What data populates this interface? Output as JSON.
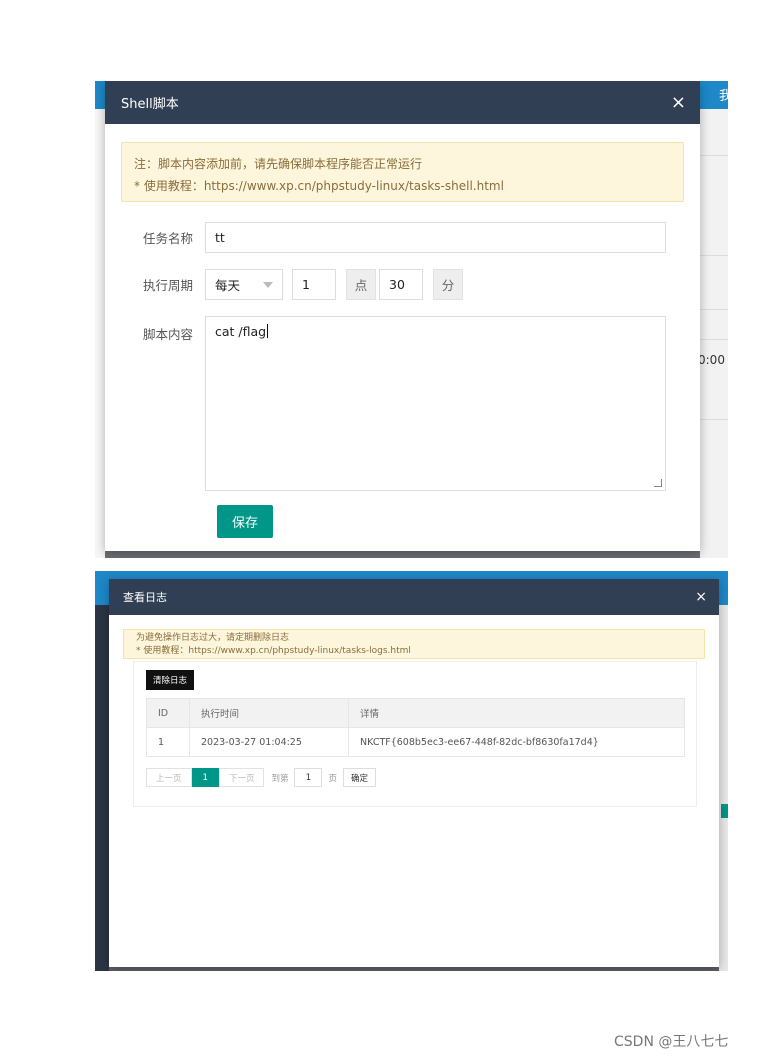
{
  "shell_dialog": {
    "title": "Shell脚本",
    "close": "×",
    "notice": {
      "line1": "注：脚本内容添加前，请先确保脚本程序能否正常运行",
      "line2": "* 使用教程：https://www.xp.cn/phpstudy-linux/tasks-shell.html"
    },
    "task_name": {
      "label": "任务名称",
      "value": "tt"
    },
    "cycle": {
      "label": "执行周期",
      "period_value": "每天",
      "hour_value": "1",
      "hour_unit": "点",
      "minute_value": "30",
      "minute_unit": "分"
    },
    "script": {
      "label": "脚本内容",
      "value": "cat /flag"
    },
    "save_label": "保存"
  },
  "log_dialog": {
    "title": "查看日志",
    "close": "×",
    "notice": {
      "line1": "为避免操作日志过大，请定期删除日志",
      "line2": "* 使用教程：https://www.xp.cn/phpstudy-linux/tasks-logs.html"
    },
    "clear_label": "清除日志",
    "table": {
      "headers": [
        "ID",
        "执行时间",
        "详情"
      ],
      "rows": [
        [
          "1",
          "2023-03-27 01:04:25",
          "NKCTF{608b5ec3-ee67-448f-82dc-bf8630fa17d4}"
        ]
      ]
    },
    "pagination": {
      "prev": "上一页",
      "current": "1",
      "next": "下一页",
      "goto_prefix": "到第",
      "goto_value": "1",
      "goto_suffix": "页",
      "confirm": "确定"
    }
  },
  "background": {
    "top_right_char": "我",
    "time_fragment": "0:00"
  },
  "watermark": "CSDN @王八七七",
  "colors": {
    "header": "#303f54",
    "accent": "#009688",
    "notice_bg": "#fdf6dc",
    "topbar": "#1e88c9"
  }
}
